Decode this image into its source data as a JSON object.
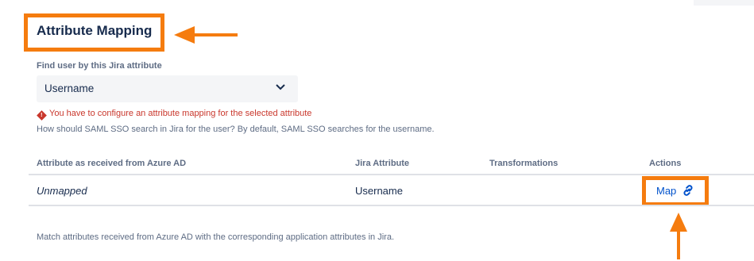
{
  "header": {
    "title": "Attribute Mapping"
  },
  "lookup": {
    "label": "Find user by this Jira attribute",
    "selected": "Username",
    "warning": "You have to configure an attribute mapping for the selected attribute",
    "help": "How should SAML SSO search in Jira for the user? By default, SAML SSO searches for the username."
  },
  "table": {
    "columns": [
      "Attribute as received from Azure AD",
      "Jira Attribute",
      "Transformations",
      "Actions"
    ],
    "rows": [
      {
        "source": "Unmapped",
        "jira_attribute": "Username",
        "transformations": "",
        "action": "Map"
      }
    ]
  },
  "footer": {
    "text": "Match attributes received from Azure AD with the corresponding application attributes in Jira."
  },
  "colors": {
    "annotation": "#f57c0f",
    "link": "#0052cc",
    "error": "#c9372c"
  },
  "icons": {
    "select": "chevron-down-icon",
    "warning": "warning-diamond-icon",
    "map": "link-icon"
  }
}
